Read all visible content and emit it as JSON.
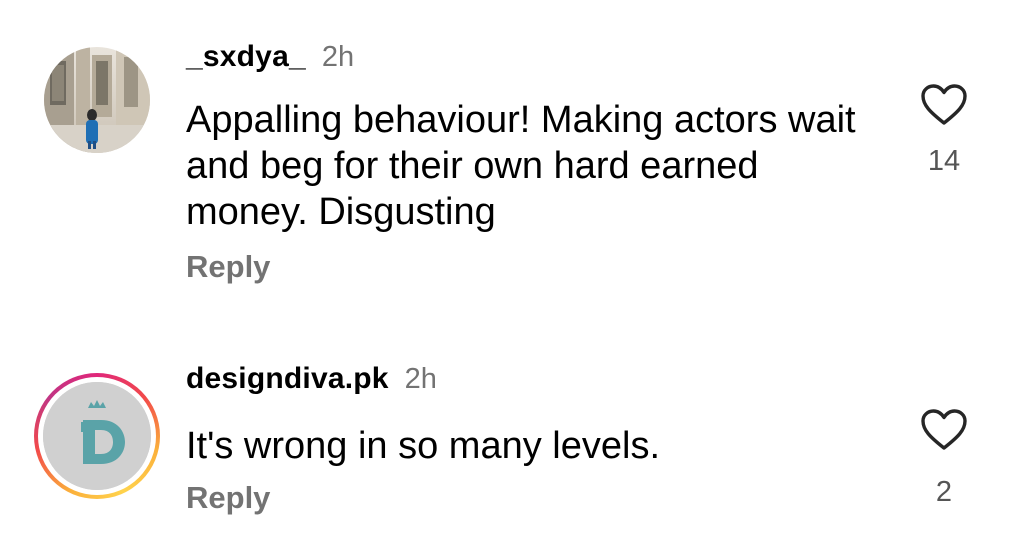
{
  "comments": [
    {
      "username": "_sxdya_",
      "time": "2h",
      "text": "Appalling behaviour! Making actors wait and beg for their own hard earned money. Disgusting",
      "reply_label": "Reply",
      "likes": "14",
      "avatar_icon": "photo-avatar"
    },
    {
      "username": "designdiva.pk",
      "time": "2h",
      "text": "It's wrong in so many levels.",
      "reply_label": "Reply",
      "likes": "2",
      "avatar_icon": "d-logo-avatar",
      "story_ring": true
    }
  ],
  "colors": {
    "secondary_text": "#737373",
    "logo_teal": "#5aa3a8",
    "story_ring": [
      "#e0277a",
      "#fbb03b"
    ]
  }
}
